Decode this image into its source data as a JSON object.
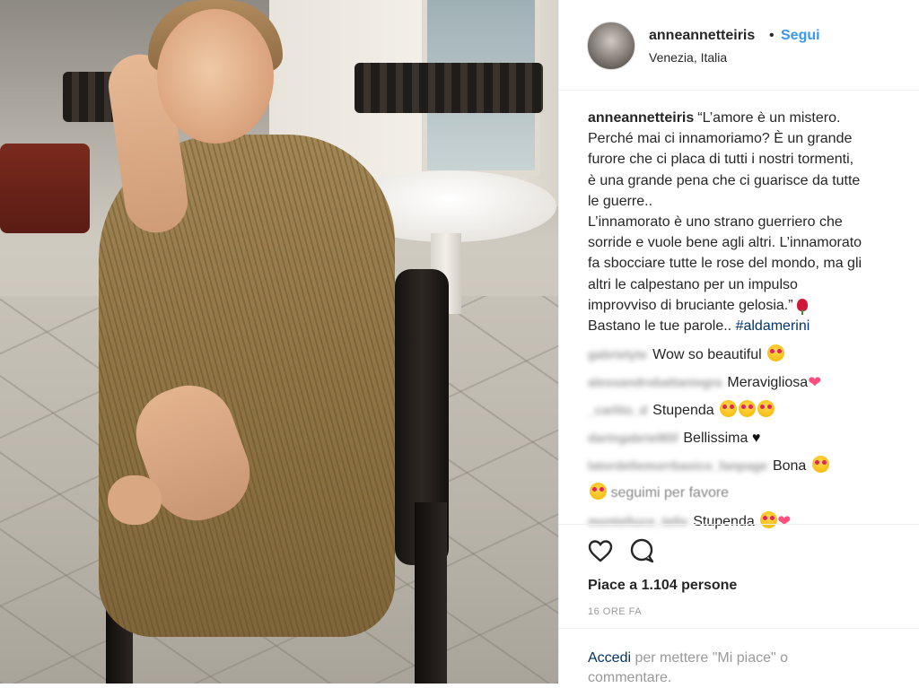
{
  "post": {
    "username": "anneannetteiris",
    "follow_label": "Segui",
    "separator": "•",
    "location": "Venezia, Italia"
  },
  "caption": {
    "username": "anneannetteiris",
    "lines": [
      "“L’amore è un mistero.",
      "Perché mai ci innamoriamo? È un grande",
      "furore che ci placa di tutti i nostri tormenti,",
      "è una grande pena che ci guarisce da tutte",
      "le guerre..",
      "L’innamorato è uno strano guerriero che",
      "sorride e vuole bene agli altri. L’innamorato",
      "fa sbocciare tutte le rose del mondo, ma gli",
      "altri le calpestano per un impulso",
      "improvviso di bruciante gelosia.”"
    ],
    "last_line_text": "Bastano le tue parole..",
    "hashtag": "#aldamerini"
  },
  "comments": [
    {
      "user": "gabrielyte",
      "text": "Wow so beautiful",
      "emoji": [
        "heart-eyes"
      ]
    },
    {
      "user": "alessandrobattaniegra",
      "text": "Meravigliosa",
      "emoji": [
        "pink-heart"
      ]
    },
    {
      "user": "_carlito_d",
      "text": "Stupenda",
      "emoji": [
        "heart-eyes",
        "heart-eyes",
        "heart-eyes"
      ]
    },
    {
      "user": "daringabriel85f",
      "text": "Bellissima",
      "emoji": [
        "black-heart"
      ]
    },
    {
      "user": "latordellemorrbasico_fanpage",
      "text": "Bona",
      "emoji": [
        "heart-eyes"
      ]
    },
    {
      "user": "",
      "text": "seguimi per favore",
      "emoji": [],
      "lead_emoji": "heart-eyes"
    },
    {
      "user": "montelluco_tello",
      "text": "Stupenda",
      "emoji": [
        "heart-eyes",
        "pink-heart"
      ]
    }
  ],
  "actions": {
    "like_icon": "heart-outline-icon",
    "comment_icon": "comment-bubble-icon"
  },
  "likes_text": "Piace a 1.104 persone",
  "timestamp": "16 ORE FA",
  "login": {
    "link": "Accedi",
    "text": " per mettere \"Mi piace\" o commentare."
  }
}
